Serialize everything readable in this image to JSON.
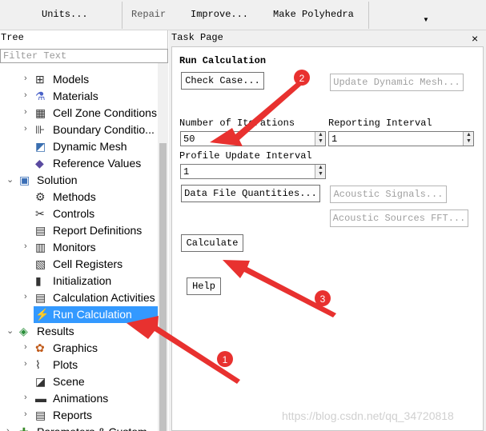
{
  "toolbar": {
    "units": "Units...",
    "repair": "Repair",
    "improve": "Improve...",
    "make_polyhedra": "Make Polyhedra"
  },
  "tree": {
    "title": "Tree",
    "filter_placeholder": "Filter Text",
    "items": [
      {
        "label": "Models",
        "icon": "models-icon"
      },
      {
        "label": "Materials",
        "icon": "flask-icon"
      },
      {
        "label": "Cell Zone Conditions",
        "icon": "cell-zone-icon"
      },
      {
        "label": "Boundary Conditio...",
        "icon": "boundary-icon"
      },
      {
        "label": "Dynamic Mesh",
        "icon": "dynamic-mesh-icon"
      },
      {
        "label": "Reference Values",
        "icon": "reference-icon"
      },
      {
        "label": "Solution",
        "icon": "solution-icon"
      },
      {
        "label": "Methods",
        "icon": "methods-icon"
      },
      {
        "label": "Controls",
        "icon": "controls-icon"
      },
      {
        "label": "Report Definitions",
        "icon": "report-def-icon"
      },
      {
        "label": "Monitors",
        "icon": "monitors-icon"
      },
      {
        "label": "Cell Registers",
        "icon": "cell-registers-icon"
      },
      {
        "label": "Initialization",
        "icon": "initialization-icon"
      },
      {
        "label": "Calculation Activities",
        "icon": "calc-activities-icon"
      },
      {
        "label": "Run Calculation",
        "icon": "lightning-icon"
      },
      {
        "label": "Results",
        "icon": "results-icon"
      },
      {
        "label": "Graphics",
        "icon": "graphics-icon"
      },
      {
        "label": "Plots",
        "icon": "plots-icon"
      },
      {
        "label": "Scene",
        "icon": "scene-icon"
      },
      {
        "label": "Animations",
        "icon": "animations-icon"
      },
      {
        "label": "Reports",
        "icon": "reports-icon"
      },
      {
        "label": "Parameters & Custom...",
        "icon": "parameters-icon"
      }
    ]
  },
  "task": {
    "title": "Task Page",
    "close": "×",
    "section_title": "Run Calculation",
    "check_case": "Check Case...",
    "update_dynamic_mesh": "Update Dynamic Mesh...",
    "num_iterations_label": "Number of Iterations",
    "num_iterations_value": "50",
    "reporting_interval_label": "Reporting Interval",
    "reporting_interval_value": "1",
    "profile_update_label": "Profile Update Interval",
    "profile_update_value": "1",
    "data_file_quantities": "Data File Quantities...",
    "acoustic_signals": "Acoustic Signals...",
    "acoustic_sources_fft": "Acoustic Sources FFT...",
    "calculate": "Calculate",
    "help": "Help"
  },
  "annotations": {
    "marker1": "1",
    "marker2": "2",
    "marker3": "3",
    "color": "#e8312f"
  },
  "watermark": "https://blog.csdn.net/qq_34720818"
}
